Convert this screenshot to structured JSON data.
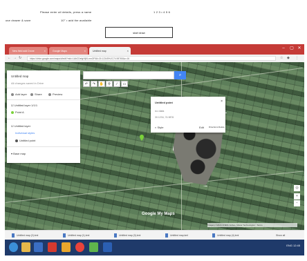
{
  "doc": {
    "line1_left": "Please enter all details, press a name",
    "line1_right": "1 2 3   •   4 5 6",
    "line2_left": "use drawer & save",
    "line2_mid": "10°   •   add the available",
    "button_label": "start draw"
  },
  "browser": {
    "tabs": [
      {
        "label": "New field add Drone"
      },
      {
        "label": "Google Maps"
      },
      {
        "label": "Untitled map"
      }
    ],
    "address": "https://drive.google.com/maps/d/edit?mid=1AbCDefgHijKLmnOP&ll=30.12345%2C74.98765&z=16",
    "window_controls": [
      "–",
      "▢",
      "✕"
    ]
  },
  "panel": {
    "title": "Untitled map",
    "subtitle": "All changes saved in Drive",
    "actions": [
      "Add layer",
      "Share",
      "Preview"
    ],
    "layer_group": "Untitled layer 1/1/1",
    "layer_item": "Point A",
    "sub_layer_title": "Untitled layer",
    "sub_layer_link": "Individual styles",
    "sub_layer_item": "Untitled point",
    "base_map": "Base map"
  },
  "search": {
    "placeholder": ""
  },
  "toolbar_icons": [
    "undo-icon",
    "redo-icon",
    "hand-icon",
    "marker-icon",
    "line-icon",
    "ruler-icon",
    "pan-icon"
  ],
  "info": {
    "title": "Untitled point",
    "description": "no data",
    "coords": "30.1234, 74.9876",
    "actions": [
      "Style",
      "Edit",
      "Directions",
      "Delete"
    ]
  },
  "map_footer": {
    "brand": "Google My Maps",
    "attribution": "Imagery ©2024 CNES / Airbus, Maxar Technologies · Terms"
  },
  "downloads": [
    "Untitled map (2).kml",
    "Untitled map (1).kml",
    "Untitled map (3).kml",
    "Untitled map.kml",
    "Untitled map (4).kml"
  ],
  "downloads_show_all": "Show all",
  "taskbar": {
    "tray_text": "ENG 12:45"
  },
  "colors": {
    "browser_red": "#c53b37",
    "accent_blue": "#4285f4",
    "taskbar": "#1f3a6a",
    "marker": "#7bd23a"
  }
}
